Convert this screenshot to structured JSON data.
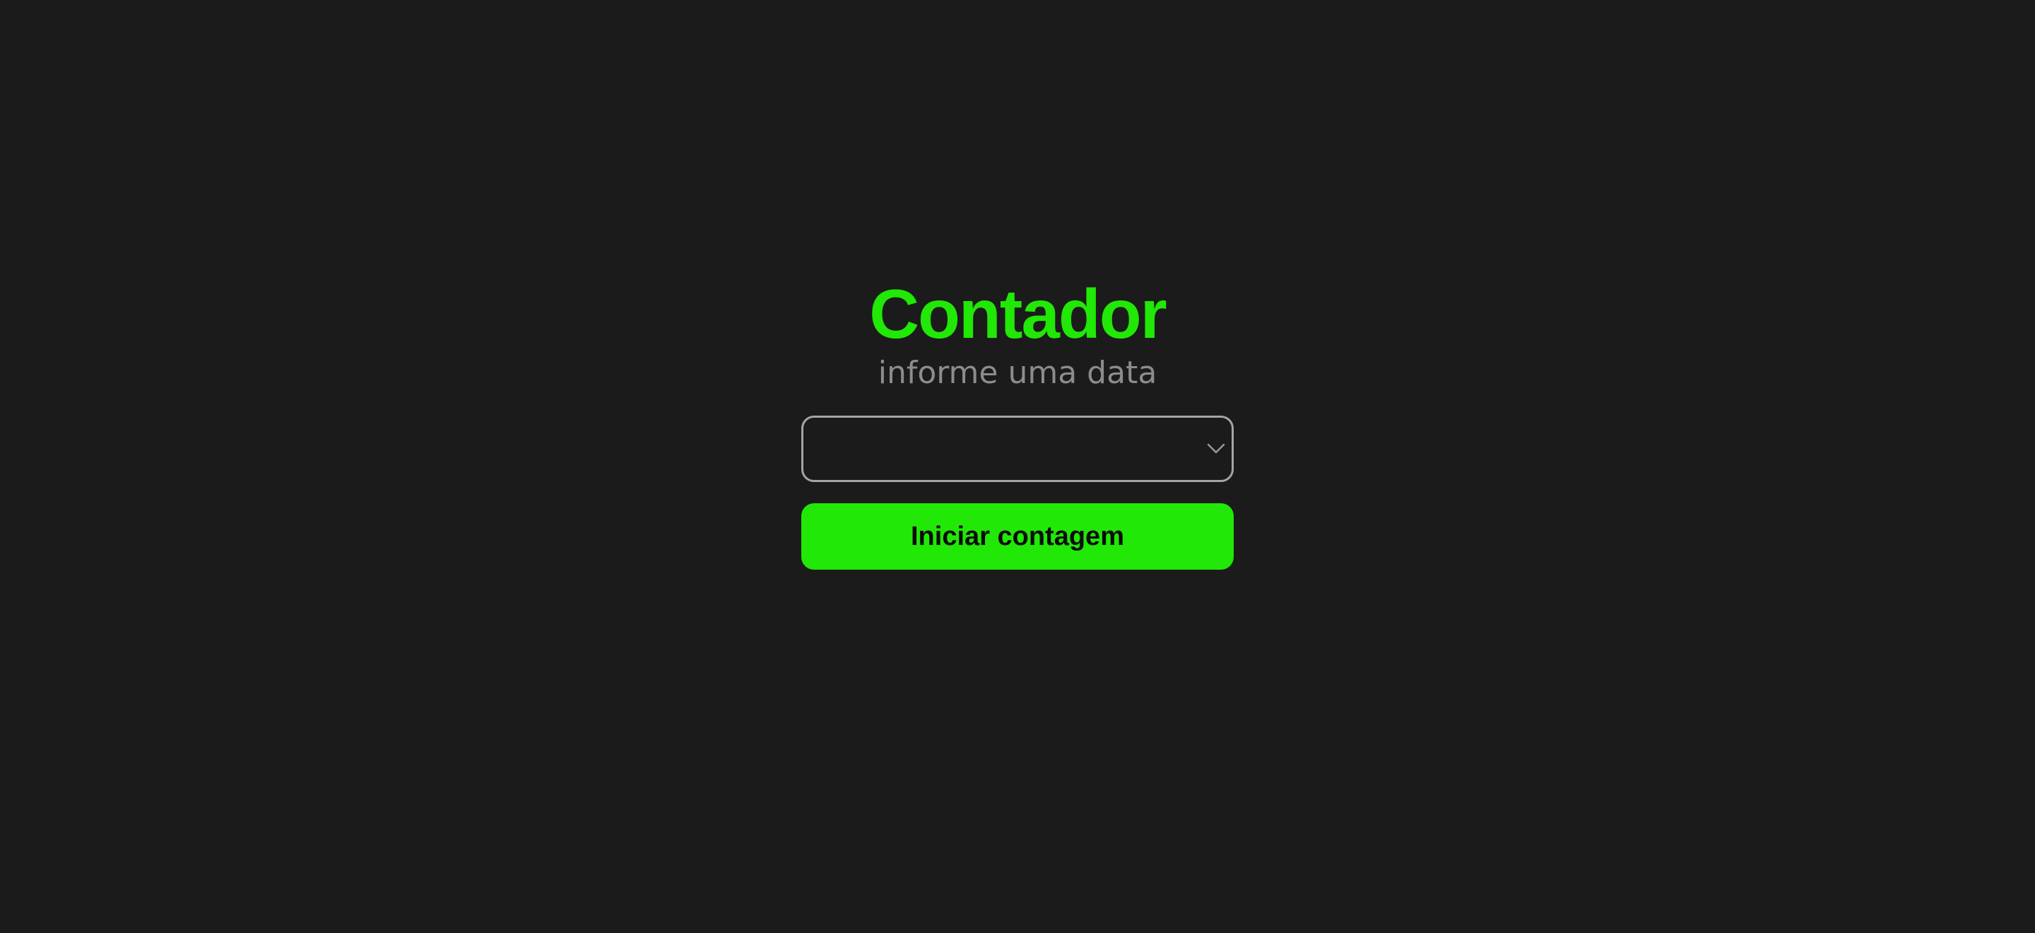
{
  "app": {
    "title": "Contador",
    "subtitle": "informe uma data"
  },
  "date_select": {
    "selected_value": "",
    "icon": "chevron-down-icon"
  },
  "actions": {
    "start_label": "Iniciar contagem"
  },
  "colors": {
    "background": "#1b1b1b",
    "accent": "#21e806",
    "subtitle_text": "#8c8c8c",
    "field_border": "#a5a5a5",
    "button_text": "#0c0c0c"
  }
}
